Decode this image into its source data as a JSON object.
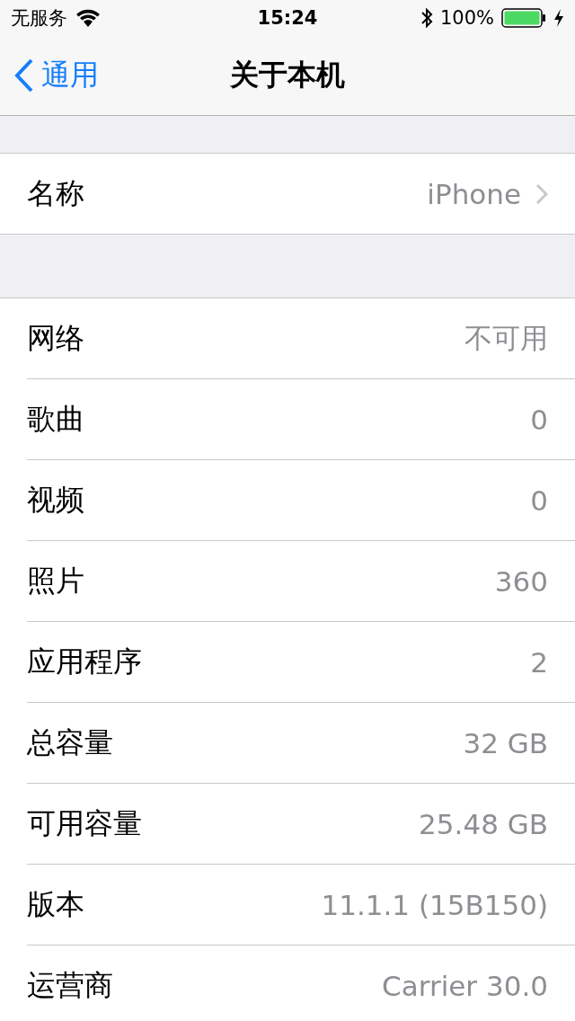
{
  "status_bar": {
    "carrier": "无服务",
    "time": "15:24",
    "battery": "100%",
    "charging": true
  },
  "nav": {
    "back": "通用",
    "title": "关于本机"
  },
  "groups": [
    {
      "rows": [
        {
          "label": "名称",
          "value": "iPhone",
          "chevron": true
        }
      ]
    },
    {
      "rows": [
        {
          "label": "网络",
          "value": "不可用",
          "chevron": false
        },
        {
          "label": "歌曲",
          "value": "0",
          "chevron": false
        },
        {
          "label": "视频",
          "value": "0",
          "chevron": false
        },
        {
          "label": "照片",
          "value": "360",
          "chevron": false
        },
        {
          "label": "应用程序",
          "value": "2",
          "chevron": false
        },
        {
          "label": "总容量",
          "value": "32 GB",
          "chevron": false
        },
        {
          "label": "可用容量",
          "value": "25.48 GB",
          "chevron": false
        },
        {
          "label": "版本",
          "value": "11.1.1 (15B150)",
          "chevron": false
        },
        {
          "label": "运营商",
          "value": "Carrier 30.0",
          "chevron": false
        }
      ]
    }
  ]
}
